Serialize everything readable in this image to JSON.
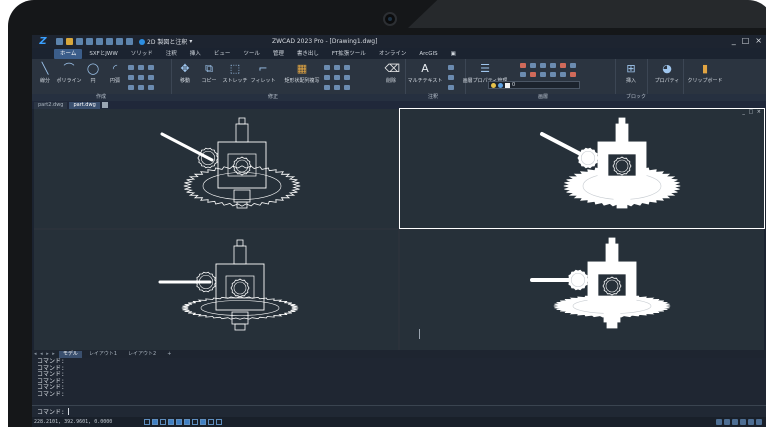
{
  "titlebar": {
    "workspace": "2D 製図と注釈",
    "title": "ZWCAD 2023 Pro - [Drawing1.dwg]",
    "controls": [
      "_",
      "□",
      "×"
    ]
  },
  "ribbon_tabs": [
    "ホーム",
    "SXFとJWW",
    "ソリッド",
    "注釈",
    "挿入",
    "ビュー",
    "ツール",
    "管理",
    "書き出し",
    "FT拡張ツール",
    "オンライン",
    "ArcGIS"
  ],
  "ribbon": {
    "draw": {
      "line": "線分",
      "polyline": "ポリライン",
      "circle": "円",
      "arc": "円弧"
    },
    "modify": {
      "move": "移動",
      "copy": "コピー",
      "stretch": "ストレッチ",
      "fillet": "フィレット",
      "array": "矩形状配列複写",
      "erase": "削除"
    },
    "annotation": {
      "mtext": "マルチテキスト"
    },
    "layers": {
      "layer_props": "画層プロパティ管理",
      "current_layer": "0"
    },
    "block": {
      "insert": "挿入"
    },
    "properties": "プロパティ",
    "clipboard": "クリップボード"
  },
  "panel_labels": {
    "draw": "作成",
    "modify": "修正",
    "annotation": "注釈",
    "layers": "画層",
    "block": "ブロック"
  },
  "doc_tabs": [
    "part2.dwg",
    "part.dwg"
  ],
  "viewport_controls": "_ □ ×",
  "layout_tabs": {
    "nav": "◂ ◂ ▸ ▸",
    "tabs": [
      "モデル",
      "レイアウト1",
      "レイアウト2",
      "+"
    ]
  },
  "command_history": [
    "コマンド:",
    "コマンド:",
    "コマンド:",
    "コマンド:",
    "コマンド:",
    "コマンド:"
  ],
  "command_prompt": "コマンド:",
  "status_coords": "228.2101, 392.9601, 0.0000",
  "colors": {
    "accent": "#3b5d8a",
    "background": "#263039",
    "model": "#ffffff"
  }
}
